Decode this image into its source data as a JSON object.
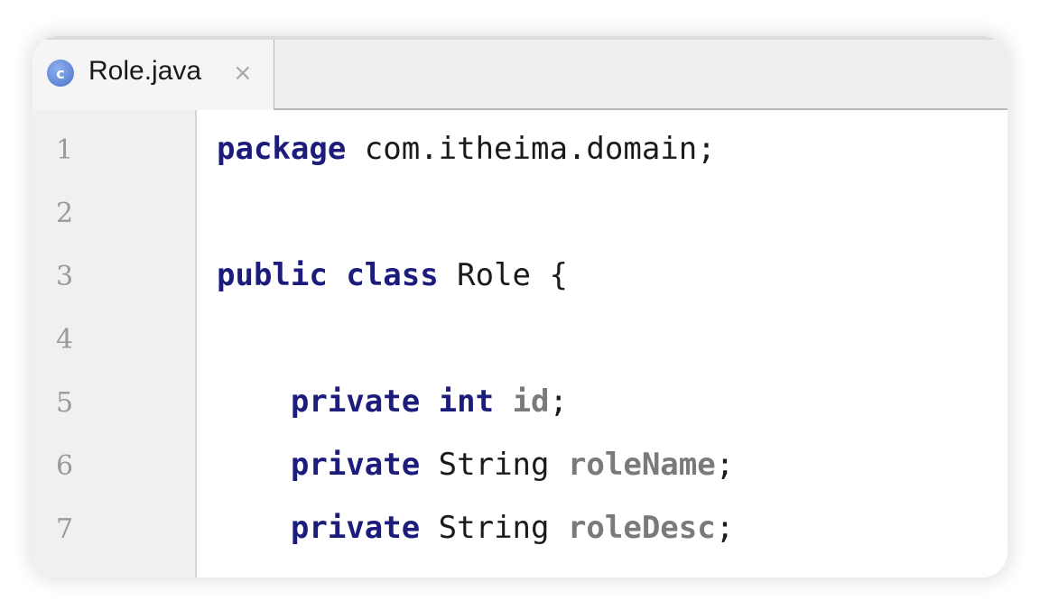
{
  "tab": {
    "icon": "class-c-icon",
    "icon_letter": "c",
    "file_name": "Role.java",
    "close_glyph": "×"
  },
  "editor": {
    "lines": [
      {
        "number": "1",
        "tokens": [
          {
            "type": "kw",
            "text": "package"
          },
          {
            "type": "plain",
            "text": " com.itheima.domain;"
          }
        ]
      },
      {
        "number": "2",
        "tokens": []
      },
      {
        "number": "3",
        "tokens": [
          {
            "type": "kw",
            "text": "public"
          },
          {
            "type": "plain",
            "text": " "
          },
          {
            "type": "kw",
            "text": "class"
          },
          {
            "type": "plain",
            "text": " Role {"
          }
        ]
      },
      {
        "number": "4",
        "tokens": []
      },
      {
        "number": "5",
        "tokens": [
          {
            "type": "plain",
            "text": "    "
          },
          {
            "type": "kw",
            "text": "private"
          },
          {
            "type": "plain",
            "text": " "
          },
          {
            "type": "kw",
            "text": "int"
          },
          {
            "type": "plain",
            "text": " "
          },
          {
            "type": "fld",
            "text": "id"
          },
          {
            "type": "plain",
            "text": ";"
          }
        ]
      },
      {
        "number": "6",
        "tokens": [
          {
            "type": "plain",
            "text": "    "
          },
          {
            "type": "kw",
            "text": "private"
          },
          {
            "type": "plain",
            "text": " String "
          },
          {
            "type": "fld",
            "text": "roleName"
          },
          {
            "type": "plain",
            "text": ";"
          }
        ]
      },
      {
        "number": "7",
        "tokens": [
          {
            "type": "plain",
            "text": "    "
          },
          {
            "type": "kw",
            "text": "private"
          },
          {
            "type": "plain",
            "text": " String "
          },
          {
            "type": "fld",
            "text": "roleDesc"
          },
          {
            "type": "plain",
            "text": ";"
          }
        ]
      }
    ]
  },
  "colors": {
    "keyword": "#1c1c7c",
    "field": "#7a7a7a",
    "gutter_background": "#f0f0f0",
    "tab_icon": "#5b82d6"
  }
}
